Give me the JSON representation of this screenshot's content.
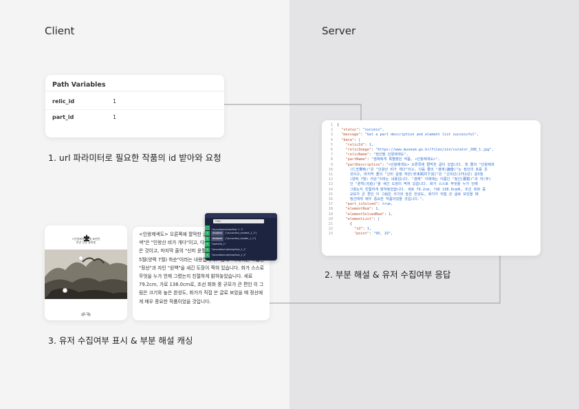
{
  "sections": {
    "client": "Client",
    "server": "Server"
  },
  "path_variables": {
    "title": "Path Variables",
    "rows": [
      {
        "key": "relic_id",
        "value": "1"
      },
      {
        "key": "part_id",
        "value": "1"
      }
    ]
  },
  "steps": {
    "step1": "1. url 파라미터로 필요한 작품의 id 받아와 요청",
    "step2": "2. 부분 해설 & 유저 수집여부 응답",
    "step3": "3. 유저 수집여부 표시 & 부분 해설 캐싱"
  },
  "json_lines": [
    "{",
    "  \"status\": \"success\",",
    "  \"message\": \"Get a part description and element list successful\",",
    "  \"data\": [",
    "    \"relicId\": 1,",
    "    \"relicImage\": \"https://www.museum.go.kr/files/zin/curator_288_1.jpg\",",
    "    \"relicName\": \"정선필 인왕제색도\",",
    "    \"partName\": \"겸재에게 특별했던 작품, <인왕제색도>\",",
    "    \"partDescription\": \"<인왕제색도> 오른쪽에 짤막한 글이 있습니다. 첫 줄의 \"인왕제색",
    "      (仁王霽色)\"은 \"인왕산 비가 개다\"이고, 다음 줄의 \"겸재(謙齋)\"는 정선의 호를 은",
    "      것이고, 마지막 줄의 \"신미 윤월 하완(辛未閏月下浣)\"은 \"신미년(1751년) 윤5월",
    "      (양력 7월) 하순\"이라는 내용입니다. \"겸재\" 아래에는 이름인 \"정선(鄭敾)\"과 자(字)",
    "      인 \"원백(元伯)\"을 새긴 도장이 찍혀 있습니다. 화가 스스로 무엇을 누가 언제",
    "      그렸는지 친절하게 밝혀놓았습니다. 세로 79.2cm, 가로 138.0cm로, 조선 회화 중",
    "      규모가 큰 편인 이 그림은 크기와 높은 완성도, 화가가 직접 쓴 글로 보았을 때",
    "      정선에게 매우 중요한 작품이었을 것입니다.\",",
    "    \"part_isSolved\": true,",
    "    \"elementNum\": 1,",
    "    \"elementSolvedNum\": 1,",
    "    \"elementList\": [",
    "      {",
    "        \"id\": 1,",
    "        \"point\": \"95, 19\","
  ],
  "phone": {
    "title_line1": "<인왕제색도>에 표현된",
    "title_line2": "한양 인왕 살펴봄",
    "pager": "1/2"
  },
  "description_text": "<인왕제색도> 오른쪽에 짤막한 글이 있습니다. 첫 줄의 \"인왕제색\"은 \"인왕산 비가 개다\"이고, 다음 줄의 \"겸재\"는 정선의 호를 은 것이고, 마지막 줄의 \"신미 윤월 하완\"은 \"신미년(1751년) 윤5월(양력 7월) 하순\"이라는 내용입니다. \"겸재\" 아래에는 이름인 \"정선\"과 자인 \"원백\"을 새긴 도장이 찍혀 있습니다. 화가 스스로 무엇을 누가 언제 그렸는지 친절하게 밝혀놓았습니다. 세로 79.2cm, 가로 138.0cm로, 조선 회화 중 규모가 큰 편인 이 그림은 크기와 높은 완성도, 화가가 직접 쓴 글로 보았을 때 정선에게 매우 중요한 작품이었을 것입니다.",
  "devtools": {
    "search_placeholder": "Filter",
    "rows": [
      {
        "num": "",
        "tag": "",
        "text": "\"/accordions/chapSolv_1_1\""
      },
      {
        "num": "1",
        "tag": "disabled",
        "text": "[\"/accordion_content_1_1\"]"
      },
      {
        "num": "1",
        "tag": "disabled",
        "text": "[\"/accordion_header_1_1\"]"
      },
      {
        "num": "1",
        "tag": "",
        "text": "\"/partInfo_1\""
      },
      {
        "num": "1",
        "tag": "",
        "text": "\"/accordionList/chapSolv_1_1\""
      },
      {
        "num": "1",
        "tag": "",
        "text": "\"/accordionList/chapSolv_1_2\""
      }
    ]
  },
  "colors": {
    "connector": "#a9a9ad",
    "left_bg": "#f4f4f5",
    "right_bg": "#e4e4e6",
    "json_key": "#b5512e",
    "json_string": "#2f6fd0"
  }
}
